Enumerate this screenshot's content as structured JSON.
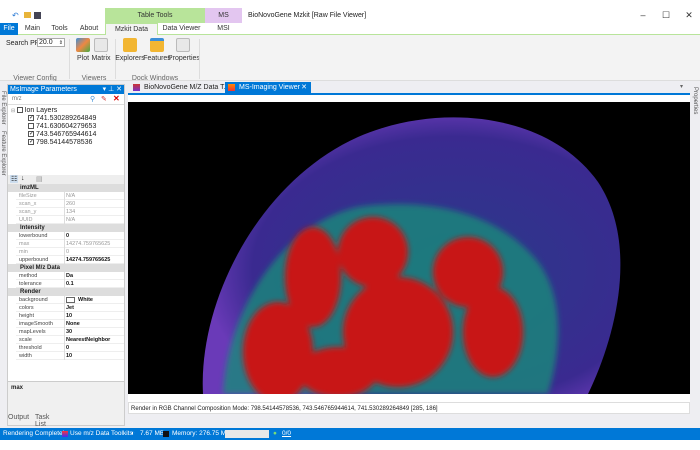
{
  "window": {
    "title": "BioNovoGene Mzkit [Raw File Viewer]",
    "minimize": "–",
    "maximize": "☐",
    "close": "✕"
  },
  "context_tabs": {
    "table_tools": "Table Tools",
    "ms_imaging": "MS Imaging"
  },
  "tabs": [
    "File",
    "Main",
    "Tools",
    "About",
    "Mzkit Data Tools",
    "Data Viewer",
    "MSI"
  ],
  "ribbon": {
    "search_ppm_label": "Search PPM",
    "search_ppm_value": "20.0",
    "groups": {
      "viewer_config": "Viewer Config",
      "viewers": "Viewers",
      "dock_windows": "Dock Windows"
    },
    "buttons": {
      "plot": "Plot",
      "matrix": "Matrix",
      "explorers": "Explorers",
      "features": "Features",
      "properties": "Properties"
    }
  },
  "left_strip": [
    "File Explorer",
    "Feature Explorer"
  ],
  "right_strip": "Properties",
  "panel": {
    "title": "MsImage Parameters",
    "search_placeholder": "m/z",
    "tree_root": "Ion Layers",
    "layers": [
      {
        "mz": "741.530289264849",
        "checked": true
      },
      {
        "mz": "741.630604279653",
        "checked": false
      },
      {
        "mz": "743.546765944614",
        "checked": true
      },
      {
        "mz": "798.54144578536",
        "checked": true
      }
    ],
    "categories": [
      {
        "name": "imzML",
        "rows": [
          [
            "fileSize",
            "N/A",
            true
          ],
          [
            "scan_x",
            "260",
            true
          ],
          [
            "scan_y",
            "134",
            true
          ],
          [
            "UUID",
            "N/A",
            true
          ]
        ]
      },
      {
        "name": "Intensity",
        "rows": [
          [
            "lowerbound",
            "0",
            false
          ],
          [
            "max",
            "14274.759765625",
            true
          ],
          [
            "min",
            "0",
            true
          ],
          [
            "upperbound",
            "14274.759765625",
            false
          ]
        ]
      },
      {
        "name": "Pixel M/z Data",
        "rows": [
          [
            "method",
            "Da",
            false
          ],
          [
            "tolerance",
            "0.1",
            false
          ]
        ]
      },
      {
        "name": "Render",
        "rows": [
          [
            "background",
            "White",
            false
          ],
          [
            "colors",
            "Jet",
            false
          ],
          [
            "height",
            "10",
            false
          ],
          [
            "imageSmooth",
            "None",
            false
          ],
          [
            "mapLevels",
            "30",
            false
          ],
          [
            "scale",
            "NearestNeighbor",
            false
          ],
          [
            "threshold",
            "0",
            false
          ],
          [
            "width",
            "10",
            false
          ]
        ]
      }
    ],
    "description": "max"
  },
  "bottom_tabs": [
    "Output",
    "Task List"
  ],
  "doc_tabs": [
    "BioNovoGene M/Z Data T...",
    "MS-Imaging Viewer"
  ],
  "viewer_status": "Render in RGB Channel Composition Mode: 798.54144578536, 743.546765944614, 741.530289264849  [285, 186]",
  "statusbar": {
    "message": "Rendering Complete!",
    "toolkit": "Use m/z Data Toolkits",
    "size": "7.67 MB",
    "memory": "Memory: 276.75 MB",
    "tasks": "0/0"
  },
  "colors": {
    "accent": "#0078d7",
    "table_tools": "#b8e49a",
    "ms_imaging": "#e3c6f0"
  }
}
